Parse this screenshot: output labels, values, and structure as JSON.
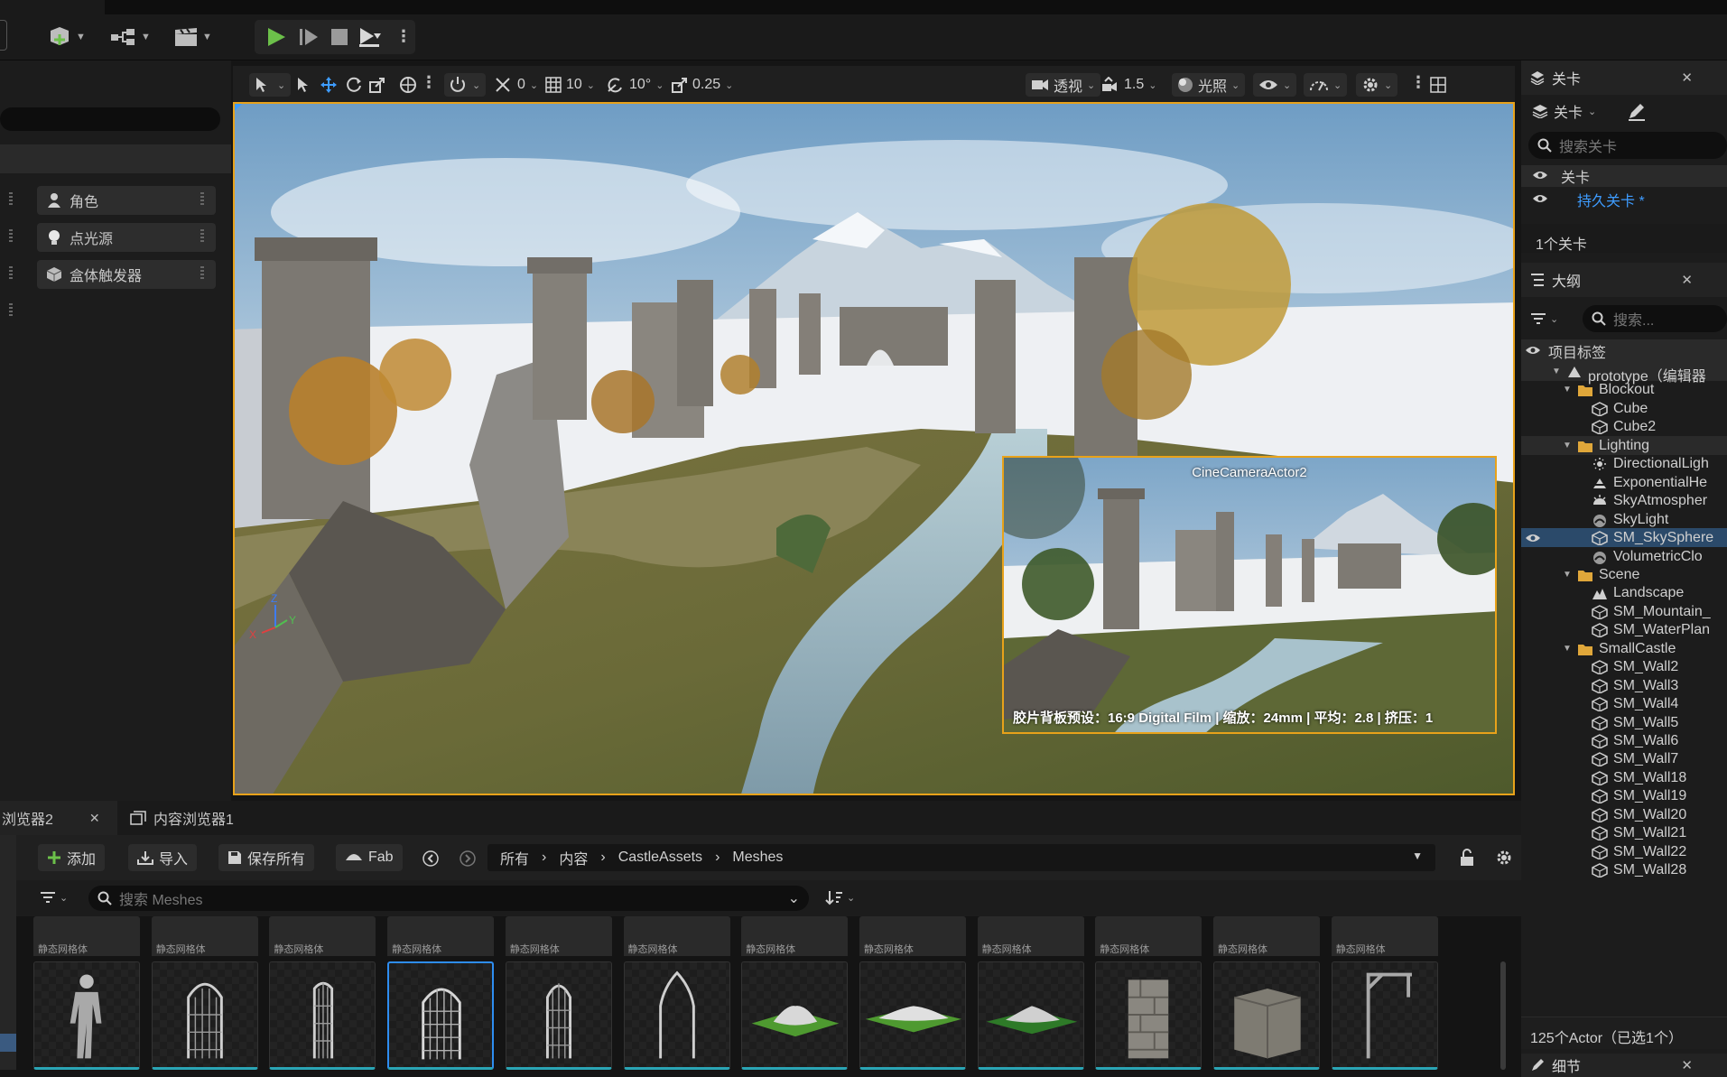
{
  "toolbar": {
    "add_icon": "add-actor-icon",
    "blueprint_icon": "blueprint-icon",
    "cinematics_icon": "clapper-icon",
    "play_icon": "play-icon",
    "advance_icon": "advance-frame-icon",
    "stop_icon": "stop-icon",
    "eject_icon": "eject-icon"
  },
  "place_actors": {
    "items": [
      "角色",
      "点光源",
      "盒体触发器"
    ]
  },
  "viewport_toolbar": {
    "snap_translate": "0",
    "grid": "10",
    "rotate": "10°",
    "scale": "0.25",
    "view_mode": "透视",
    "camera_speed": "1.5",
    "lighting": "光照"
  },
  "viewport": {
    "pip_camera_name": "CineCameraActor2",
    "pip_info": "胶片背板预设：16:9 Digital Film | 缩放：24mm | 平均：2.8 | 挤压：1",
    "axis_z": "Z",
    "axis_x": "X",
    "axis_y": "Y"
  },
  "levels_panel": {
    "title": "关卡",
    "dropdown": "关卡",
    "search_placeholder": "搜索关卡",
    "rows": [
      "关卡",
      "持久关卡 *"
    ],
    "count": "1个关卡"
  },
  "outliner": {
    "title": "大纲",
    "search_placeholder": "搜索...",
    "column": "项目标签",
    "rows": [
      {
        "label": "prototype（编辑器",
        "level": 0,
        "type": "world",
        "eye": false
      },
      {
        "label": "Blockout",
        "level": 1,
        "type": "folder",
        "eye": false
      },
      {
        "label": "Cube",
        "level": 2,
        "type": "mesh",
        "eye": false
      },
      {
        "label": "Cube2",
        "level": 2,
        "type": "mesh",
        "eye": false
      },
      {
        "label": "Lighting",
        "level": 1,
        "type": "folder",
        "eye": false
      },
      {
        "label": "DirectionalLigh",
        "level": 2,
        "type": "light",
        "eye": false
      },
      {
        "label": "ExponentialHe",
        "level": 2,
        "type": "fog",
        "eye": false
      },
      {
        "label": "SkyAtmospher",
        "level": 2,
        "type": "sky",
        "eye": false
      },
      {
        "label": "SkyLight",
        "level": 2,
        "type": "skylight",
        "eye": false
      },
      {
        "label": "SM_SkySphere",
        "level": 2,
        "type": "mesh",
        "eye": true
      },
      {
        "label": "VolumetricClo",
        "level": 2,
        "type": "skylight",
        "eye": false
      },
      {
        "label": "Scene",
        "level": 1,
        "type": "folder",
        "eye": false
      },
      {
        "label": "Landscape",
        "level": 2,
        "type": "landscape",
        "eye": false
      },
      {
        "label": "SM_Mountain_",
        "level": 2,
        "type": "mesh",
        "eye": false
      },
      {
        "label": "SM_WaterPlan",
        "level": 2,
        "type": "mesh",
        "eye": false
      },
      {
        "label": "SmallCastle",
        "level": 1,
        "type": "folder",
        "eye": false
      },
      {
        "label": "SM_Wall2",
        "level": 2,
        "type": "mesh",
        "eye": false
      },
      {
        "label": "SM_Wall3",
        "level": 2,
        "type": "mesh",
        "eye": false
      },
      {
        "label": "SM_Wall4",
        "level": 2,
        "type": "mesh",
        "eye": false
      },
      {
        "label": "SM_Wall5",
        "level": 2,
        "type": "mesh",
        "eye": false
      },
      {
        "label": "SM_Wall6",
        "level": 2,
        "type": "mesh",
        "eye": false
      },
      {
        "label": "SM_Wall7",
        "level": 2,
        "type": "mesh",
        "eye": false
      },
      {
        "label": "SM_Wall18",
        "level": 2,
        "type": "mesh",
        "eye": false
      },
      {
        "label": "SM_Wall19",
        "level": 2,
        "type": "mesh",
        "eye": false
      },
      {
        "label": "SM_Wall20",
        "level": 2,
        "type": "mesh",
        "eye": false
      },
      {
        "label": "SM_Wall21",
        "level": 2,
        "type": "mesh",
        "eye": false
      },
      {
        "label": "SM_Wall22",
        "level": 2,
        "type": "mesh",
        "eye": false
      },
      {
        "label": "SM_Wall28",
        "level": 2,
        "type": "mesh",
        "eye": false
      }
    ],
    "status": "125个Actor（已选1个）",
    "details_title": "细节"
  },
  "content_browser": {
    "tab1": "浏览器2",
    "tab2": "内容浏览器1",
    "add": "添加",
    "import": "导入",
    "save_all": "保存所有",
    "fab": "Fab",
    "crumbs": [
      "所有",
      "内容",
      "CastleAssets",
      "Meshes"
    ],
    "search_placeholder": "搜索 Meshes",
    "asset_type": "静态网格体",
    "assets": [
      {
        "thumb": "mannequin",
        "selected": false
      },
      {
        "thumb": "arch-grid",
        "selected": false
      },
      {
        "thumb": "door-grid-side",
        "selected": false
      },
      {
        "thumb": "door-grid-front",
        "selected": true
      },
      {
        "thumb": "door-grid-narrow",
        "selected": false
      },
      {
        "thumb": "gothic-arch",
        "selected": false
      },
      {
        "thumb": "mountain-small",
        "selected": false
      },
      {
        "thumb": "mountain-flat",
        "selected": false
      },
      {
        "thumb": "mountain-wide",
        "selected": false
      },
      {
        "thumb": "stone-tower",
        "selected": false
      },
      {
        "thumb": "stone-block",
        "selected": false
      },
      {
        "thumb": "gallows",
        "selected": false
      }
    ]
  },
  "colors": {
    "accent_orange": "#e8a21a",
    "play_green": "#6cc04a",
    "selection_blue": "#2e8df0",
    "link_blue": "#3e9cff"
  }
}
